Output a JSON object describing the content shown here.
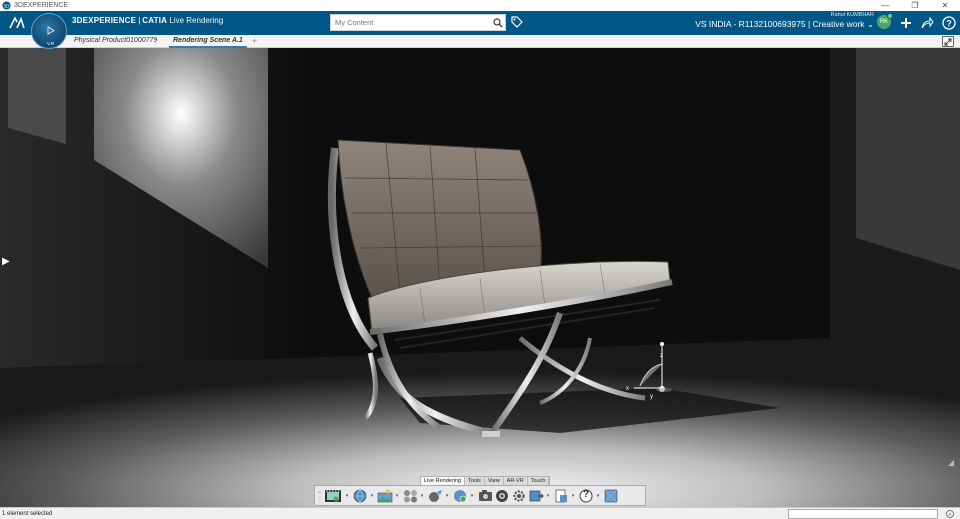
{
  "window": {
    "title": "3DEXPERIENCE",
    "controls": [
      "—",
      "❐",
      "✕"
    ]
  },
  "header": {
    "brand_bold": "3DEXPERIENCE",
    "brand_sep": "|",
    "brand_product": "CATIA",
    "brand_app": "Live Rendering",
    "search_placeholder": "My Content",
    "user_name": "Rahul KUMBHAR",
    "context": "VS INDIA - R1132100693975 | Creative work",
    "avatar_initials": "RK",
    "compass_version": "V.R",
    "accent_color": "#005686"
  },
  "tabs": [
    {
      "label": "Physical Product01000779",
      "active": false
    },
    {
      "label": "Rendering Scene A.1",
      "active": true
    }
  ],
  "tab_add": "+",
  "viewport": {
    "axis_labels": {
      "x": "x",
      "y": "y",
      "z": "z"
    }
  },
  "actionbar": {
    "tabs": [
      {
        "label": "Live Rendering",
        "active": true
      },
      {
        "label": "Tools",
        "active": false
      },
      {
        "label": "View",
        "active": false
      },
      {
        "label": "AR-VR",
        "active": false
      },
      {
        "label": "Touch",
        "active": false
      }
    ],
    "buttons": [
      "film-strip-icon",
      "globe-environment-icon",
      "scene-picture-icon",
      "spheres-material-icon",
      "lighting-sphere-icon",
      "render-globe-icon",
      "camera-icon",
      "aperture-icon",
      "gear-settings-icon",
      "export-image-icon",
      "document-export-icon",
      "help-icon",
      "cube-preview-icon"
    ],
    "help_glyph": "?"
  },
  "status": {
    "text": "1 element selected"
  }
}
